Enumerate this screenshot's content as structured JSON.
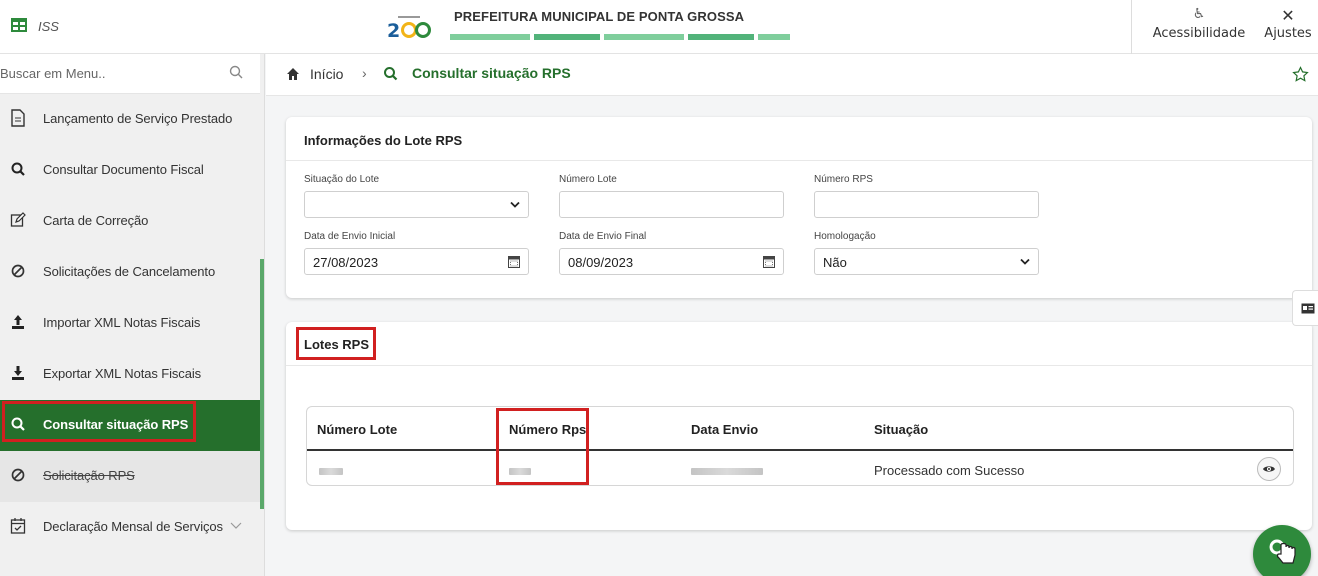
{
  "header": {
    "app_name": "ISS",
    "org_title": "PREFEITURA MUNICIPAL DE PONTA GROSSA",
    "logo_text": "200",
    "accessibility_label": "Acessibilidade",
    "settings_label": "Ajustes"
  },
  "sidebar": {
    "search_placeholder": "Buscar em Menu..",
    "items": [
      {
        "label": "Lançamento de Serviço Prestado",
        "icon": "document-icon"
      },
      {
        "label": "Consultar Documento Fiscal",
        "icon": "search-icon"
      },
      {
        "label": "Carta de Correção",
        "icon": "edit-icon"
      },
      {
        "label": "Solicitações de Cancelamento",
        "icon": "ban-icon"
      },
      {
        "label": "Importar XML Notas Fiscais",
        "icon": "upload-icon"
      },
      {
        "label": "Exportar XML Notas Fiscais",
        "icon": "download-icon"
      },
      {
        "label": "Consultar situação RPS",
        "icon": "search-icon"
      },
      {
        "label": "Solicitação RPS",
        "icon": "ban-icon"
      },
      {
        "label": "Declaração Mensal de Serviços",
        "icon": "calendar-check-icon"
      }
    ]
  },
  "breadcrumb": {
    "home": "Início",
    "current": "Consultar situação RPS"
  },
  "filters": {
    "title": "Informações do Lote RPS",
    "situacao_label": "Situação do Lote",
    "situacao_value": "",
    "numero_lote_label": "Número Lote",
    "numero_lote_value": "",
    "numero_rps_label": "Número RPS",
    "numero_rps_value": "",
    "data_inicial_label": "Data de Envio Inicial",
    "data_inicial_value": "27/08/2023",
    "data_final_label": "Data de Envio Final",
    "data_final_value": "08/09/2023",
    "homologacao_label": "Homologação",
    "homologacao_value": "Não"
  },
  "lotes": {
    "title": "Lotes RPS",
    "columns": [
      "Número Lote",
      "Número Rps",
      "Data Envio",
      "Situação"
    ],
    "rows": [
      {
        "situacao": "Processado com Sucesso"
      }
    ]
  },
  "colors": {
    "brand_green": "#256f2c",
    "highlight_red": "#d12020"
  }
}
